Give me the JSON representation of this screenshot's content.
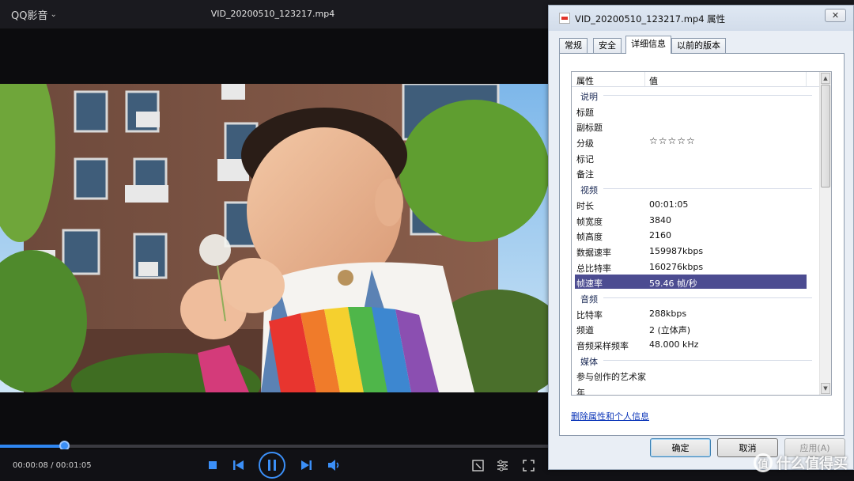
{
  "player": {
    "app_title": "QQ影音",
    "file_title": "VID_20200510_123217.mp4",
    "timecode": "00:00:08 / 00:01:05",
    "progress_fraction": 0.075
  },
  "dialog": {
    "title": "VID_20200510_123217.mp4 属性",
    "close_label": "✕",
    "tabs": [
      "常规",
      "安全",
      "详细信息",
      "以前的版本"
    ],
    "active_tab": "详细信息",
    "columns": {
      "property": "属性",
      "value": "值"
    },
    "rows": [
      {
        "type": "group",
        "k": "说明"
      },
      {
        "k": "标题",
        "v": ""
      },
      {
        "k": "副标题",
        "v": ""
      },
      {
        "k": "分级",
        "v": "☆☆☆☆☆"
      },
      {
        "k": "标记",
        "v": ""
      },
      {
        "k": "备注",
        "v": ""
      },
      {
        "type": "group",
        "k": "视频"
      },
      {
        "k": "时长",
        "v": "00:01:05"
      },
      {
        "k": "帧宽度",
        "v": "3840"
      },
      {
        "k": "帧高度",
        "v": "2160"
      },
      {
        "k": "数据速率",
        "v": "159987kbps"
      },
      {
        "k": "总比特率",
        "v": "160276kbps"
      },
      {
        "k": "帧速率",
        "v": "59.46 帧/秒",
        "selected": true
      },
      {
        "type": "group",
        "k": "音频"
      },
      {
        "k": "比特率",
        "v": "288kbps"
      },
      {
        "k": "频道",
        "v": "2 (立体声)"
      },
      {
        "k": "音频采样频率",
        "v": "48.000 kHz"
      },
      {
        "type": "group",
        "k": "媒体"
      },
      {
        "k": "参与创作的艺术家",
        "v": ""
      },
      {
        "k": "年",
        "v": ""
      }
    ],
    "remove_link": "删除属性和个人信息",
    "buttons": {
      "ok": "确定",
      "cancel": "取消",
      "apply": "应用(A)"
    }
  },
  "watermark": {
    "text": "什么值得买",
    "logo": "值"
  },
  "colors": {
    "accent": "#3b8ff7",
    "selection": "#4c4c91",
    "link": "#0b35b8"
  }
}
